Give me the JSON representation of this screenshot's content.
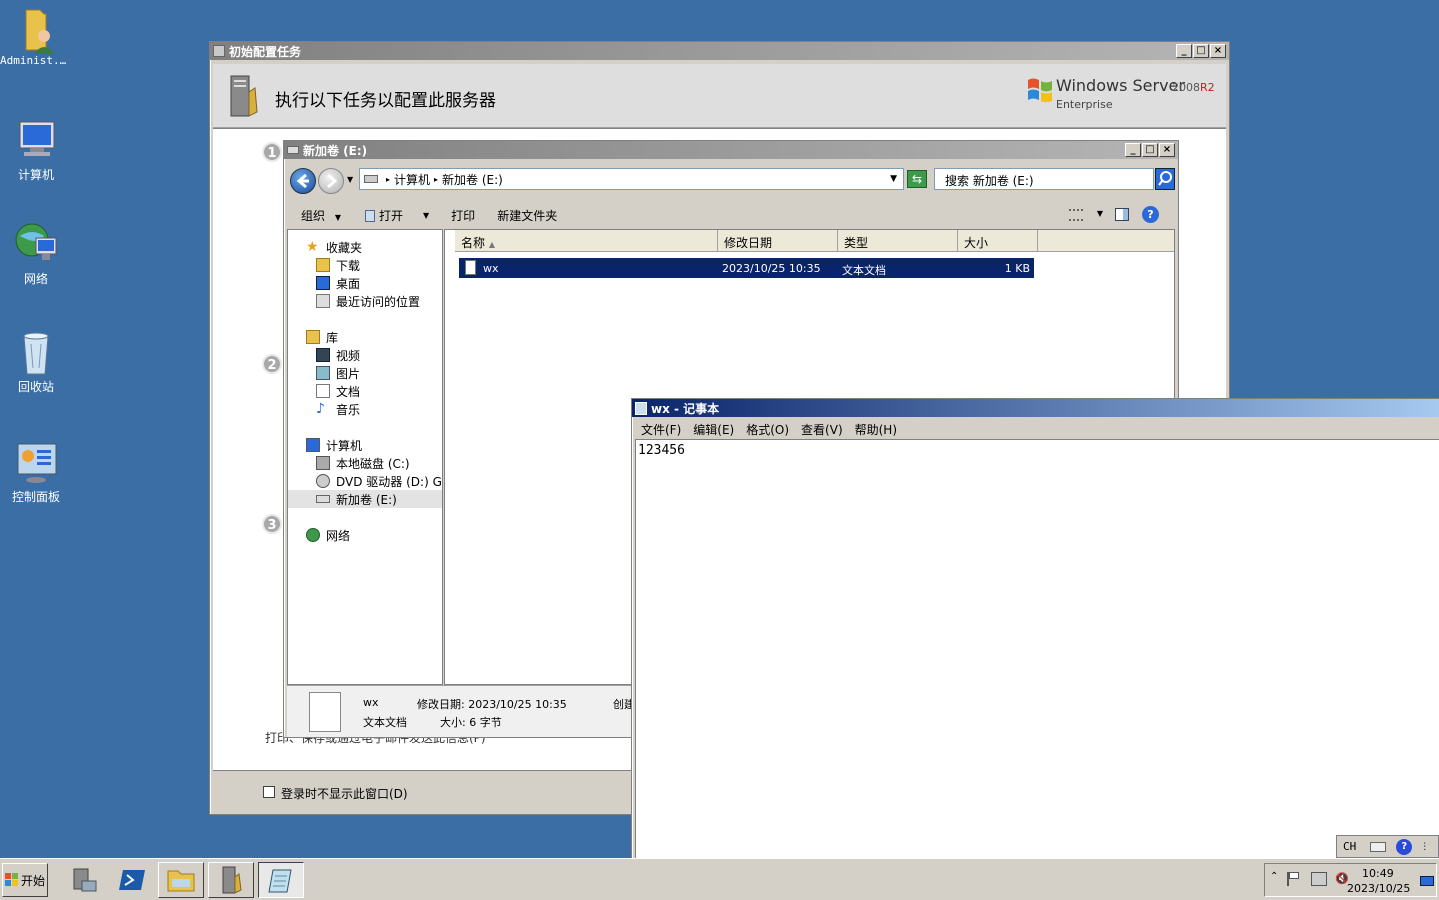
{
  "desktop": {
    "icons": [
      {
        "label": "Administ..."
      },
      {
        "label": "计算机"
      },
      {
        "label": "网络"
      },
      {
        "label": "回收站"
      },
      {
        "label": "控制面板"
      }
    ]
  },
  "config_window": {
    "title": "初始配置任务",
    "heading": "执行以下任务以配置此服务器",
    "brand": {
      "name": "Windows Server",
      "version": "2008",
      "edition_suffix": "R2",
      "edition": "Enterprise"
    },
    "steps": [
      "1",
      "2",
      "3"
    ],
    "print_link": "打印、保存或通过电子邮件发送此信息(P)",
    "footer_checkbox": "登录时不显示此窗口(D)"
  },
  "explorer": {
    "title": "新加卷 (E:)",
    "breadcrumb": [
      "计算机",
      "新加卷 (E:)"
    ],
    "search_placeholder": "搜索 新加卷 (E:)",
    "commands": {
      "organize": "组织",
      "open": "打开",
      "print": "打印",
      "new_folder": "新建文件夹"
    },
    "nav": {
      "favorites": "收藏夹",
      "downloads": "下载",
      "desktop": "桌面",
      "recent": "最近访问的位置",
      "libraries": "库",
      "videos": "视频",
      "pictures": "图片",
      "documents": "文档",
      "music": "音乐",
      "computer": "计算机",
      "local_disk": "本地磁盘 (C:)",
      "dvd": "DVD 驱动器 (D:) GF",
      "new_volume": "新加卷 (E:)",
      "network": "网络"
    },
    "columns": [
      "名称",
      "修改日期",
      "类型",
      "大小"
    ],
    "files": [
      {
        "name": "wx",
        "modified": "2023/10/25 10:35",
        "type": "文本文档",
        "size": "1 KB"
      }
    ],
    "details": {
      "name": "wx",
      "type": "文本文档",
      "modified_label": "修改日期: 2023/10/25 10:35",
      "size_label": "大小: 6 字节",
      "created_label": "创建"
    }
  },
  "notepad": {
    "title": "wx - 记事本",
    "menus": [
      "文件(F)",
      "编辑(E)",
      "格式(O)",
      "查看(V)",
      "帮助(H)"
    ],
    "content": "123456"
  },
  "taskbar": {
    "start": "开始",
    "lang": "CH",
    "clock_time": "10:49",
    "clock_date": "2023/10/25"
  },
  "colors": {
    "desktop": "#3a6ea5",
    "active_title": "#0a246a",
    "selection": "#0a246a"
  }
}
